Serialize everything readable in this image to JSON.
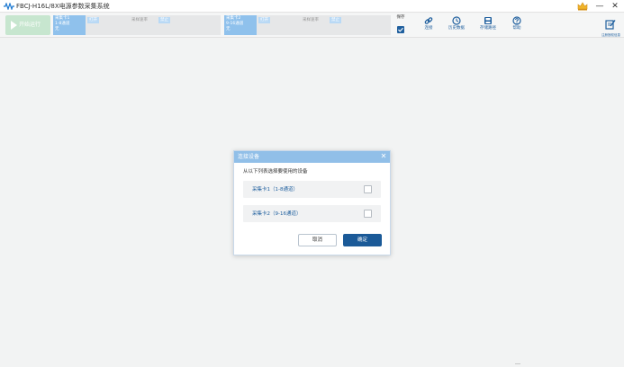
{
  "window": {
    "title": "FBCJ-H16L/8X电源参数采集系统",
    "minimize": "—",
    "close": "✕"
  },
  "toolbar": {
    "start_label": "开始运行",
    "cards": [
      {
        "name": "采集卡1",
        "channels": "1-8通道",
        "status": "无",
        "tag": "打开",
        "rate_label": "采样速率",
        "tag2": "禁止"
      },
      {
        "name": "采集卡2",
        "channels": "9-16通道",
        "status": "无",
        "tag": "打开",
        "rate_label": "采样速率",
        "tag2": "禁止"
      }
    ],
    "save_label": "保存",
    "save_checked": true,
    "tools": [
      {
        "label": "连接",
        "icon": "link-icon"
      },
      {
        "label": "历史数据",
        "icon": "history-icon"
      },
      {
        "label": "存储路径",
        "icon": "storage-icon"
      },
      {
        "label": "帮助",
        "icon": "help-icon"
      }
    ],
    "right_tool_label": "注册授权信息"
  },
  "dialog": {
    "title": "连接设备",
    "close": "✕",
    "prompt": "从以下列表选择要使用的设备",
    "devices": [
      {
        "label": "采集卡1（1-8通道）",
        "checked": false
      },
      {
        "label": "采集卡2（9-16通道）",
        "checked": false
      }
    ],
    "cancel": "取消",
    "ok": "确定"
  },
  "colors": {
    "accent": "#1b5a98",
    "dialog_header": "#91bfe8",
    "card_tile": "#8fc1ec",
    "start_button": "#c7e6cf",
    "background": "#f2f3f3"
  }
}
